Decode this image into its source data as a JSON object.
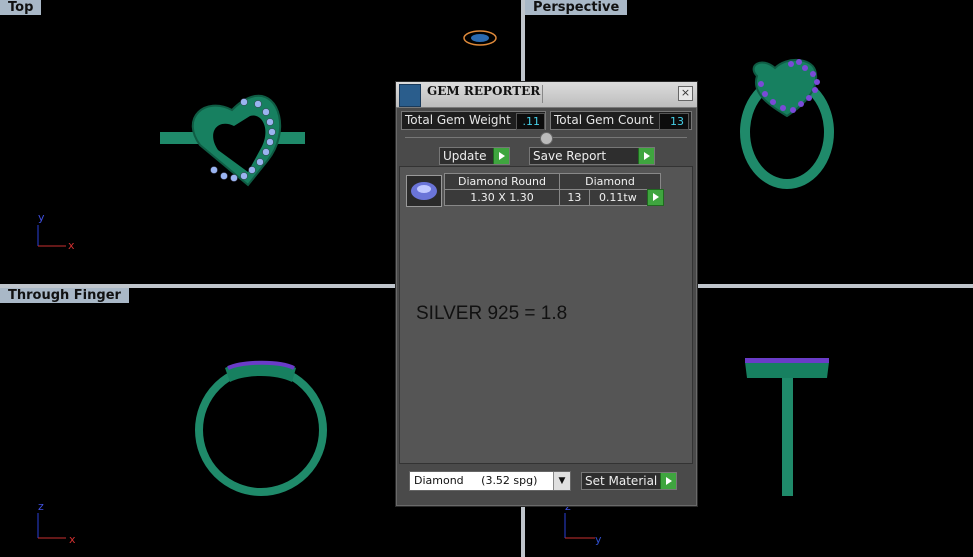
{
  "viewports": {
    "top": {
      "title": "Top"
    },
    "perspective": {
      "title": "Perspective"
    },
    "through_finger": {
      "title": "Through Finger"
    },
    "side": {
      "title": ""
    }
  },
  "axes": {
    "top": {
      "a": "y",
      "b": "x"
    },
    "through_finger": {
      "a": "z",
      "b": "x"
    },
    "side": {
      "a": "z",
      "b": "y"
    }
  },
  "dialog": {
    "title": "GEM REPORTER",
    "close_glyph": "×",
    "total_gem_weight_label": "Total Gem Weight",
    "total_gem_weight_value": ".11",
    "total_gem_count_label": "Total Gem Count",
    "total_gem_count_value": "13",
    "update_label": "Update",
    "save_report_label": "Save Report",
    "gem_row": {
      "shape": "Diamond Round",
      "material": "Diamond",
      "size": "1.30 X 1.30",
      "count": "13",
      "weight": "0.11tw"
    },
    "note": "SILVER 925 = 1.8",
    "material_select": "Diamond     (3.52 spg)",
    "set_material_label": "Set Material"
  },
  "colors": {
    "ring_green": "#1f8a6a",
    "gem_purple": "#6a3cc8",
    "gem_blue": "#9ab4f0",
    "accent_green": "#3fa53f",
    "value_cyan": "#46d0e8"
  }
}
